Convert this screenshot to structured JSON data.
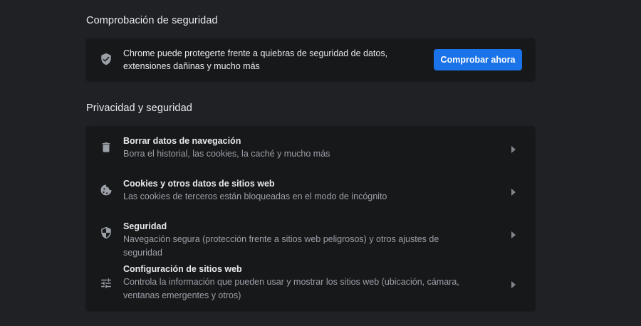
{
  "safety_check": {
    "title": "Comprobación de seguridad",
    "icon": "shield-check-icon",
    "description": "Chrome puede protegerte frente a quiebras de seguridad de datos, extensiones dañinas y mucho más",
    "button_label": "Comprobar ahora",
    "button_color": "#1a73e8"
  },
  "privacy": {
    "title": "Privacidad y seguridad",
    "items": [
      {
        "icon": "trash-icon",
        "label": "Borrar datos de navegación",
        "sublabel": "Borra el historial, las cookies, la caché y mucho más"
      },
      {
        "icon": "cookie-icon",
        "label": "Cookies y otros datos de sitios web",
        "sublabel": "Las cookies de terceros están bloqueadas en el modo de incógnito"
      },
      {
        "icon": "shield-icon",
        "label": "Seguridad",
        "sublabel": "Navegación segura (protección frente a sitios web peligrosos) y otros ajustes de seguridad"
      },
      {
        "icon": "tune-icon",
        "label": "Configuración de sitios web",
        "sublabel": "Controla la información que pueden usar y mostrar los sitios web (ubicación, cámara, ventanas emergentes y otros)"
      }
    ]
  },
  "colors": {
    "background": "#202124",
    "card": "#17181a",
    "text_primary": "#e8eaed",
    "text_secondary": "#9aa0a6",
    "accent": "#1a73e8"
  }
}
